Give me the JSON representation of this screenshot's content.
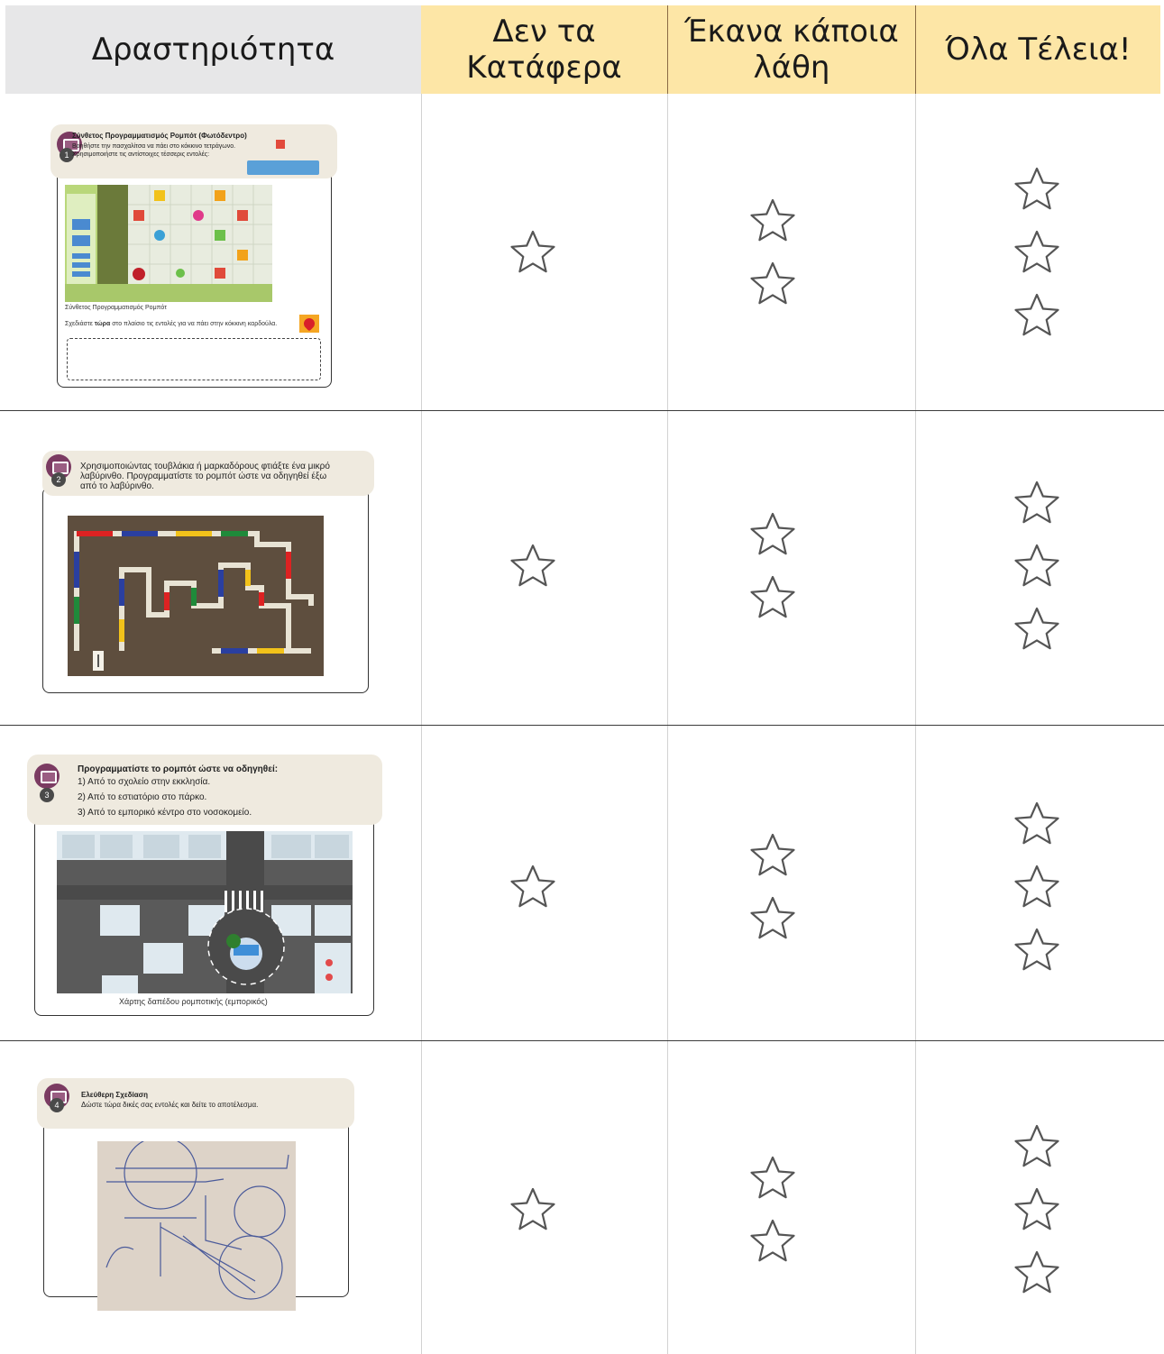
{
  "header": {
    "activity": "Δραστηριότητα",
    "col1": "Δεν τα Κατάφερα",
    "col2": "Έκανα κάποια λάθη",
    "col3": "Όλα Τέλεια!"
  },
  "rows": [
    {
      "number": "1",
      "title": "Σύνθετος Προγραμματισμός Ρομπότ (Φωτόδεντρο)",
      "line1": "Βοηθήστε την πασχαλίτσα να πάει στο κόκκινο τετράγωνο.",
      "line2": "Χρησιμοποιήστε τις αντίστοιχες τέσσερις εντολές:",
      "image_caption": "Σύνθετος Προγραμματισμός Ρομπότ",
      "instruction_pre": "Σχεδιάστε ",
      "instruction_bold": "τώρα",
      "instruction_post": " στο πλαίσιο τις εντολές για να πάει στην κόκκινη καρδούλα."
    },
    {
      "number": "2",
      "line1": "Χρησιμοποιώντας τουβλάκια ή μαρκαδόρους φτιάξτε ένα μικρό",
      "line2": "λαβύρινθο. Προγραμματίστε το ρομπότ ώστε να οδηγηθεί έξω",
      "line3": "από το λαβύρινθο."
    },
    {
      "number": "3",
      "title": "Προγραμματίστε το ρομπότ ώστε να οδηγηθεί:",
      "line1": "1) Από το σχολείο στην εκκλησία.",
      "line2": "2) Από το εστιατόριο στο πάρκο.",
      "line3": "3) Από το εμπορικό κέντρο στο νοσοκομείο.",
      "image_caption": "Χάρτης δαπέδου ρομποτικής (εμπορικός)"
    },
    {
      "number": "4",
      "title": "Ελεύθερη Σχεδίαση",
      "line1": "Δώστε τώρα δικές σας εντολές και δείτε το αποτέλεσμα."
    }
  ],
  "rating_stars": {
    "col1": 1,
    "col2": 2,
    "col3": 3
  },
  "colors": {
    "header_gray": "#e7e7e8",
    "header_yellow": "#fde6a6",
    "banner": "#efeadf",
    "icon": "#7b3b62"
  }
}
